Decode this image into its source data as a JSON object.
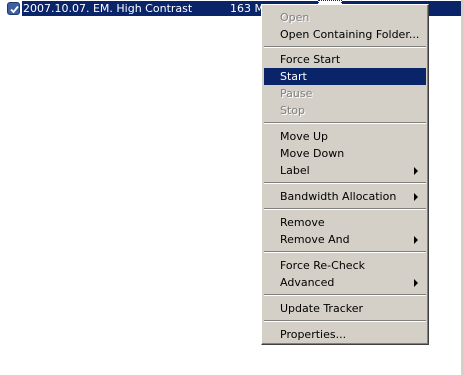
{
  "torrent_row": {
    "name": "2007.10.07. EM. High Contrast",
    "size": "163 M"
  },
  "context_menu": {
    "open": "Open",
    "open_containing_folder": "Open Containing Folder...",
    "force_start": "Force Start",
    "start": "Start",
    "pause": "Pause",
    "stop": "Stop",
    "move_up": "Move Up",
    "move_down": "Move Down",
    "label": "Label",
    "bandwidth_allocation": "Bandwidth Allocation",
    "remove": "Remove",
    "remove_and": "Remove And",
    "force_recheck": "Force Re-Check",
    "advanced": "Advanced",
    "update_tracker": "Update Tracker",
    "properties": "Properties..."
  },
  "colors": {
    "selection": "#0a246a",
    "menu_face": "#d4d0c8",
    "disabled_text": "#808080"
  }
}
